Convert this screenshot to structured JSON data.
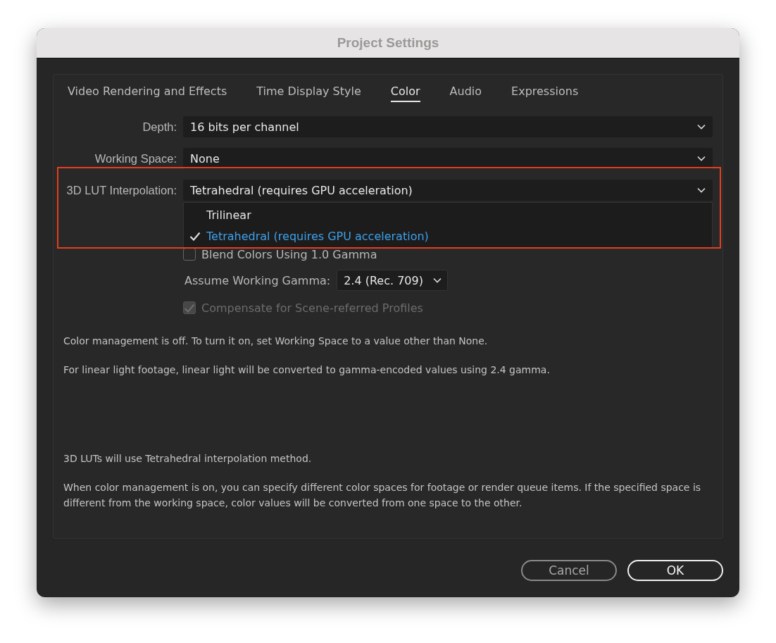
{
  "window": {
    "title": "Project Settings"
  },
  "tabs": [
    {
      "label": "Video Rendering and Effects",
      "selected": false
    },
    {
      "label": "Time Display Style",
      "selected": false
    },
    {
      "label": "Color",
      "selected": true
    },
    {
      "label": "Audio",
      "selected": false
    },
    {
      "label": "Expressions",
      "selected": false
    }
  ],
  "fields": [
    {
      "label": "Depth:",
      "value": "16 bits per channel",
      "highlighted": false
    },
    {
      "label": "Working Space:",
      "value": "None",
      "highlighted": false
    },
    {
      "label": "3D LUT Interpolation:",
      "value": "Tetrahedral (requires GPU acceleration)",
      "highlighted": true,
      "menu": [
        {
          "label": "Trilinear",
          "selected": false
        },
        {
          "label": "Tetrahedral (requires GPU acceleration)",
          "selected": true
        }
      ]
    }
  ],
  "blend_checkbox": {
    "label": "Blend Colors Using 1.0 Gamma",
    "checked": false,
    "disabled": false
  },
  "gamma": {
    "label": "Assume Working Gamma:",
    "value": "2.4 (Rec. 709)"
  },
  "compensate_checkbox": {
    "label": "Compensate for Scene-referred Profiles",
    "checked": true,
    "disabled": true
  },
  "notes_top": [
    "Color management is off. To turn it on, set Working Space to a value other than None.",
    "For linear light footage, linear light will be converted to gamma-encoded values using 2.4 gamma."
  ],
  "notes_bottom": [
    "3D LUTs will use Tetrahedral interpolation method.",
    "When color management is on, you can specify different color spaces for footage or render queue items. If the specified space is different from the working space, color values will be converted from one space to the other."
  ],
  "buttons": [
    {
      "label": "Cancel",
      "default": false
    },
    {
      "label": "OK",
      "default": true
    }
  ]
}
